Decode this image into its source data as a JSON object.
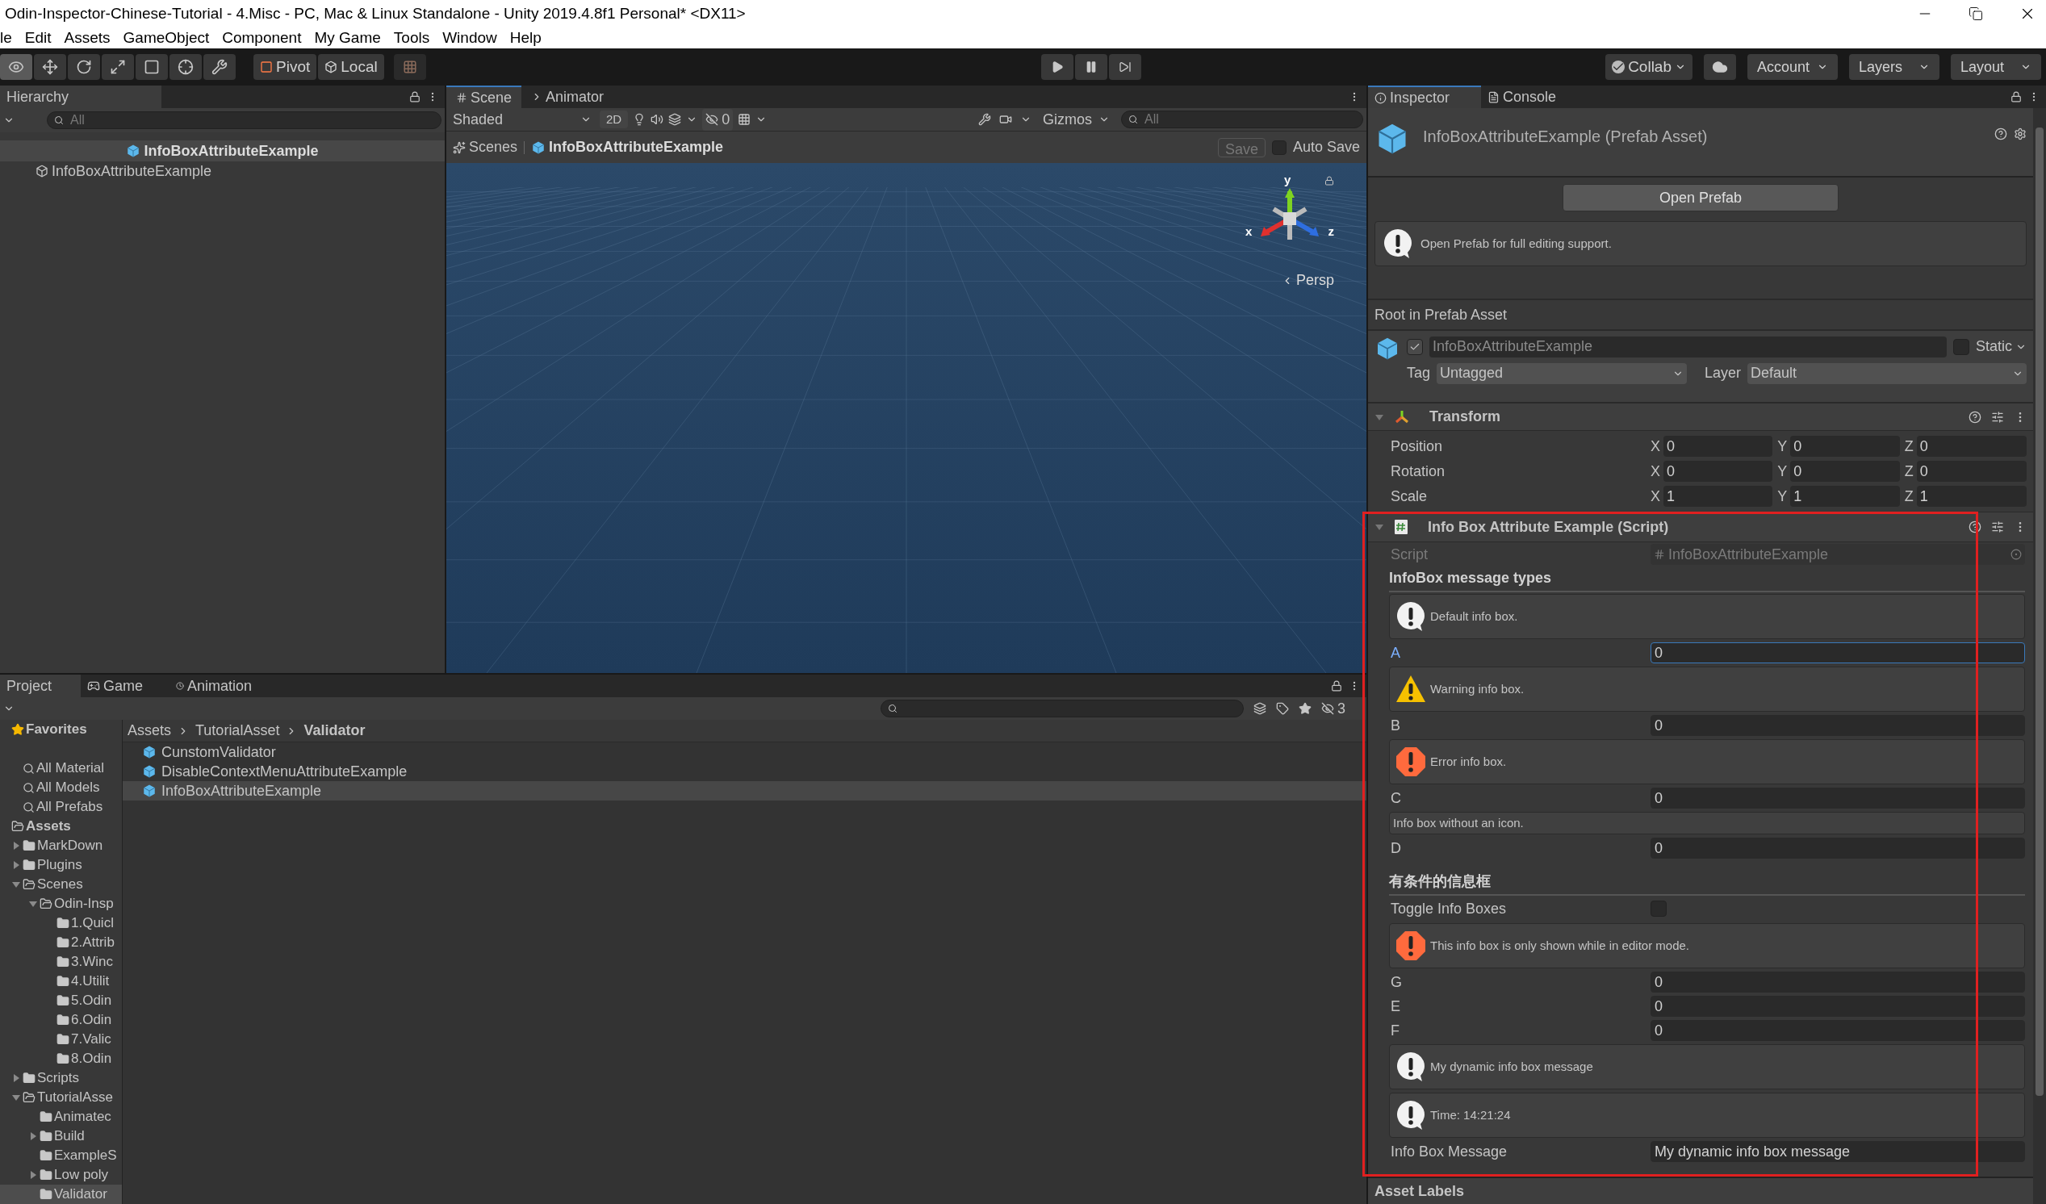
{
  "window": {
    "title": "Odin-Inspector-Chinese-Tutorial - 4.Misc - PC, Mac & Linux Standalone - Unity 2019.4.8f1 Personal* <DX11>"
  },
  "menu": [
    "le",
    "Edit",
    "Assets",
    "GameObject",
    "Component",
    "My Game",
    "Tools",
    "Window",
    "Help"
  ],
  "toolbar": {
    "pivot": "Pivot",
    "local": "Local",
    "collab": "Collab",
    "account": "Account",
    "layers": "Layers",
    "layout": "Layout"
  },
  "hierarchy": {
    "tab": "Hierarchy",
    "search_placeholder": "All",
    "prefab_header": "InfoBoxAttributeExample",
    "items": [
      {
        "label": "InfoBoxAttributeExample",
        "selected": false
      }
    ]
  },
  "scene": {
    "tabs": [
      {
        "label": "Scene",
        "selected": true
      },
      {
        "label": "Animator",
        "selected": false
      }
    ],
    "shading": "Shaded",
    "mode_2d": "2D",
    "hidden_count": "0",
    "gizmos": "Gizmos",
    "search_placeholder": "All",
    "breadcrumbs": [
      "Scenes",
      "InfoBoxAttributeExample"
    ],
    "save": "Save",
    "auto_save": {
      "label": "Auto Save",
      "checked": false
    },
    "gizmo_axes": {
      "y": "y",
      "x": "x",
      "z": "z"
    },
    "projection": "Persp"
  },
  "project": {
    "tabs": [
      {
        "label": "Project",
        "selected": true,
        "kind": "project"
      },
      {
        "label": "Game",
        "selected": false,
        "kind": "game"
      },
      {
        "label": "Animation",
        "selected": false,
        "kind": "animation"
      }
    ],
    "hidden_count": "3",
    "tree": [
      {
        "label": "Favorites",
        "kind": "favorites",
        "selected": false,
        "children": [
          {
            "label": "All Material",
            "kind": "search",
            "selected": false
          },
          {
            "label": "All Models",
            "kind": "search",
            "selected": false
          },
          {
            "label": "All Prefabs",
            "kind": "search",
            "selected": false
          }
        ]
      },
      {
        "label": "Assets",
        "kind": "root",
        "selected": false,
        "children": [
          {
            "label": "MarkDown",
            "kind": "folder",
            "expanded": false,
            "selected": false
          },
          {
            "label": "Plugins",
            "kind": "folder",
            "expanded": false,
            "selected": false
          },
          {
            "label": "Scenes",
            "kind": "folder",
            "expanded": true,
            "selected": false,
            "children": [
              {
                "label": "Odin-Insp",
                "kind": "folder",
                "expanded": true,
                "selected": false,
                "children": [
                  {
                    "label": "1.Quicl",
                    "kind": "folder",
                    "selected": false
                  },
                  {
                    "label": "2.Attrib",
                    "kind": "folder",
                    "selected": false
                  },
                  {
                    "label": "3.Winc",
                    "kind": "folder",
                    "selected": false
                  },
                  {
                    "label": "4.Utilit",
                    "kind": "folder",
                    "selected": false
                  },
                  {
                    "label": "5.Odin",
                    "kind": "folder",
                    "selected": false
                  },
                  {
                    "label": "6.Odin",
                    "kind": "folder",
                    "selected": false
                  },
                  {
                    "label": "7.Valic",
                    "kind": "folder",
                    "selected": false
                  },
                  {
                    "label": "8.Odin",
                    "kind": "folder",
                    "selected": false
                  }
                ]
              }
            ]
          },
          {
            "label": "Scripts",
            "kind": "folder",
            "expanded": false,
            "selected": false
          },
          {
            "label": "TutorialAsse",
            "kind": "folder",
            "expanded": true,
            "selected": false,
            "children": [
              {
                "label": "Animatec",
                "kind": "folder",
                "selected": false
              },
              {
                "label": "Build",
                "kind": "folder",
                "expanded": false,
                "selected": false
              },
              {
                "label": "ExampleS",
                "kind": "folder",
                "selected": false
              },
              {
                "label": "Low poly",
                "kind": "folder",
                "expanded": false,
                "selected": false
              },
              {
                "label": "Validator",
                "kind": "folder",
                "selected": true
              }
            ]
          }
        ]
      }
    ],
    "breadcrumbs": [
      "Assets",
      "TutorialAsset",
      "Validator"
    ],
    "files": [
      {
        "name": "CunstomValidator",
        "selected": false
      },
      {
        "name": "DisableContextMenuAttributeExample",
        "selected": false
      },
      {
        "name": "InfoBoxAttributeExample",
        "selected": true
      }
    ]
  },
  "inspector": {
    "tabs": [
      {
        "label": "Inspector",
        "selected": true,
        "kind": "inspector"
      },
      {
        "label": "Console",
        "selected": false,
        "kind": "console"
      }
    ],
    "title": "InfoBoxAttributeExample (Prefab Asset)",
    "open_button": "Open Prefab",
    "notice": "Open Prefab for full editing support.",
    "section": "Root in Prefab Asset",
    "object": {
      "active": true,
      "name": "InfoBoxAttributeExample",
      "static_label": "Static",
      "static": false,
      "tag_label": "Tag",
      "tag": "Untagged",
      "layer_label": "Layer",
      "layer": "Default"
    },
    "transform": {
      "title": "Transform",
      "expanded": true,
      "rows": [
        {
          "label": "Position",
          "values": [
            {
              "axis": "X",
              "value": "0"
            },
            {
              "axis": "Y",
              "value": "0"
            },
            {
              "axis": "Z",
              "value": "0"
            }
          ]
        },
        {
          "label": "Rotation",
          "values": [
            {
              "axis": "X",
              "value": "0"
            },
            {
              "axis": "Y",
              "value": "0"
            },
            {
              "axis": "Z",
              "value": "0"
            }
          ]
        },
        {
          "label": "Scale",
          "values": [
            {
              "axis": "X",
              "value": "1"
            },
            {
              "axis": "Y",
              "value": "1"
            },
            {
              "axis": "Z",
              "value": "1"
            }
          ]
        }
      ]
    },
    "script_component": {
      "title": "Info Box Attribute Example (Script)",
      "expanded": true,
      "script_label": "Script",
      "script_value": "InfoBoxAttributeExample",
      "items": [
        {
          "kind": "header",
          "text": "InfoBox message types"
        },
        {
          "kind": "info_box",
          "text": "Default info box."
        },
        {
          "kind": "field",
          "label": "A",
          "value": "0",
          "focused": true
        },
        {
          "kind": "warning_box",
          "text": "Warning info box."
        },
        {
          "kind": "field",
          "label": "B",
          "value": "0",
          "focused": false
        },
        {
          "kind": "error_box",
          "text": "Error info box."
        },
        {
          "kind": "field",
          "label": "C",
          "value": "0",
          "focused": false
        },
        {
          "kind": "plain_box",
          "text": "Info box without an icon."
        },
        {
          "kind": "field",
          "label": "D",
          "value": "0",
          "focused": false
        },
        {
          "kind": "header",
          "text": "有条件的信息框"
        },
        {
          "kind": "toggle",
          "label": "Toggle Info Boxes",
          "checked": false
        },
        {
          "kind": "error_box",
          "text": "This info box is only shown while in editor mode."
        },
        {
          "kind": "field",
          "label": "G",
          "value": "0",
          "focused": false
        },
        {
          "kind": "field",
          "label": "E",
          "value": "0",
          "focused": false
        },
        {
          "kind": "field",
          "label": "F",
          "value": "0",
          "focused": false
        },
        {
          "kind": "info_box",
          "text": "My dynamic info box message"
        },
        {
          "kind": "info_box",
          "text": "Time: 14:21:24"
        },
        {
          "kind": "field",
          "label": "Info Box Message",
          "value": "My dynamic info box message",
          "focused": false
        }
      ]
    },
    "asset_labels": "Asset Labels"
  }
}
